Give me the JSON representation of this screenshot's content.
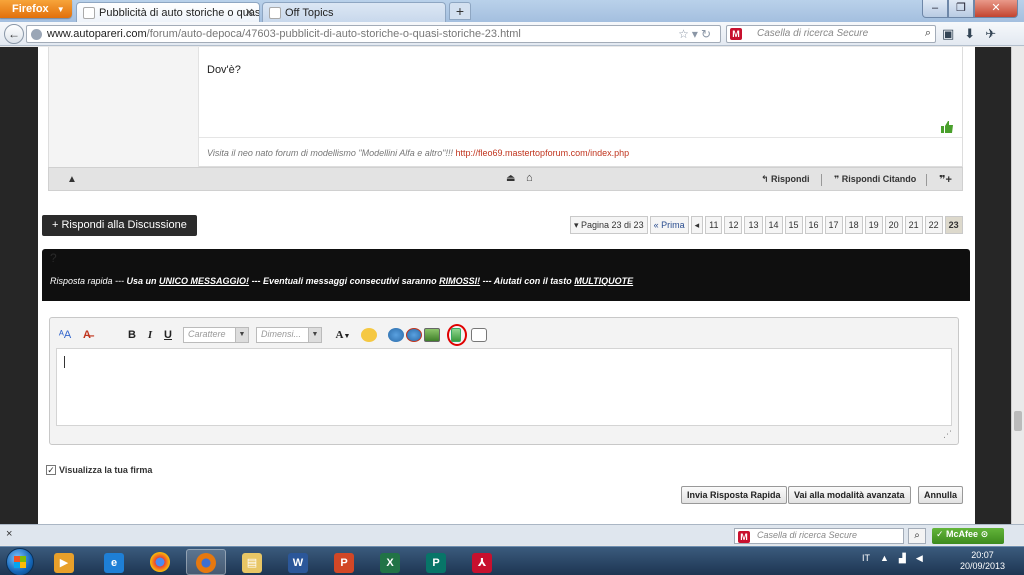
{
  "browser": {
    "firefox_label": "Firefox",
    "tabs": [
      {
        "title": "Pubblicità di auto storiche o quasi sto..."
      },
      {
        "title": "Off Topics"
      }
    ],
    "url_host": "www.autopareri.com",
    "url_path": "/forum/auto-depoca/47603-pubblicit-di-auto-storiche-o-quasi-storiche-23.html",
    "search_placeholder": "Casella di ricerca Secure"
  },
  "post": {
    "message": "Dov'è?",
    "signature_text": "Visita il neo nato forum di modellismo \"Modellini Alfa e altro\"!!! ",
    "signature_link": "http://fleo69.mastertopforum.com/index.php",
    "reply_label": "Rispondi",
    "reply_quote_label": "Rispondi Citando"
  },
  "thread": {
    "reply_button": "+ Rispondi alla Discussione",
    "page_info": "▾ Pagina 23 di 23",
    "first_label": "« Prima",
    "prev_label": "◂",
    "pages": [
      "11",
      "12",
      "13",
      "14",
      "15",
      "16",
      "17",
      "18",
      "19",
      "20",
      "21",
      "22",
      "23"
    ],
    "current_page": "23"
  },
  "quick_reply": {
    "question_mark": "?",
    "t1": "Risposta rapida --- ",
    "t2": "Usa un ",
    "t3": "UNICO MESSAGGIO!",
    "t4": " --- Eventuali messaggi consecutivi saranno ",
    "t5": "RIMOSSI!",
    "t6": " --- Aiutati con il tasto ",
    "t7": "MULTIQUOTE"
  },
  "editor": {
    "font_combo": "Carattere",
    "size_combo": "Dimensi...",
    "bold": "B",
    "italic": "I",
    "underline": "U",
    "font_color": "A"
  },
  "form": {
    "signature_option": "Visualizza la tua firma",
    "send_button": "Invia Risposta Rapida",
    "advanced_button": "Vai alla modalità avanzata",
    "cancel_button": "Annulla"
  },
  "statusbar": {
    "close": "×",
    "search_placeholder": "Casella di ricerca Secure",
    "mcafee_label": "McAfee"
  },
  "taskbar": {
    "lang": "IT",
    "time": "20:07",
    "date": "20/09/2013"
  },
  "colors": {
    "accent_dark": "#2b2b2b",
    "signature_link": "#c0341d",
    "highlight_circle": "#e00000",
    "mcafee_green": "#4c9e2a"
  }
}
